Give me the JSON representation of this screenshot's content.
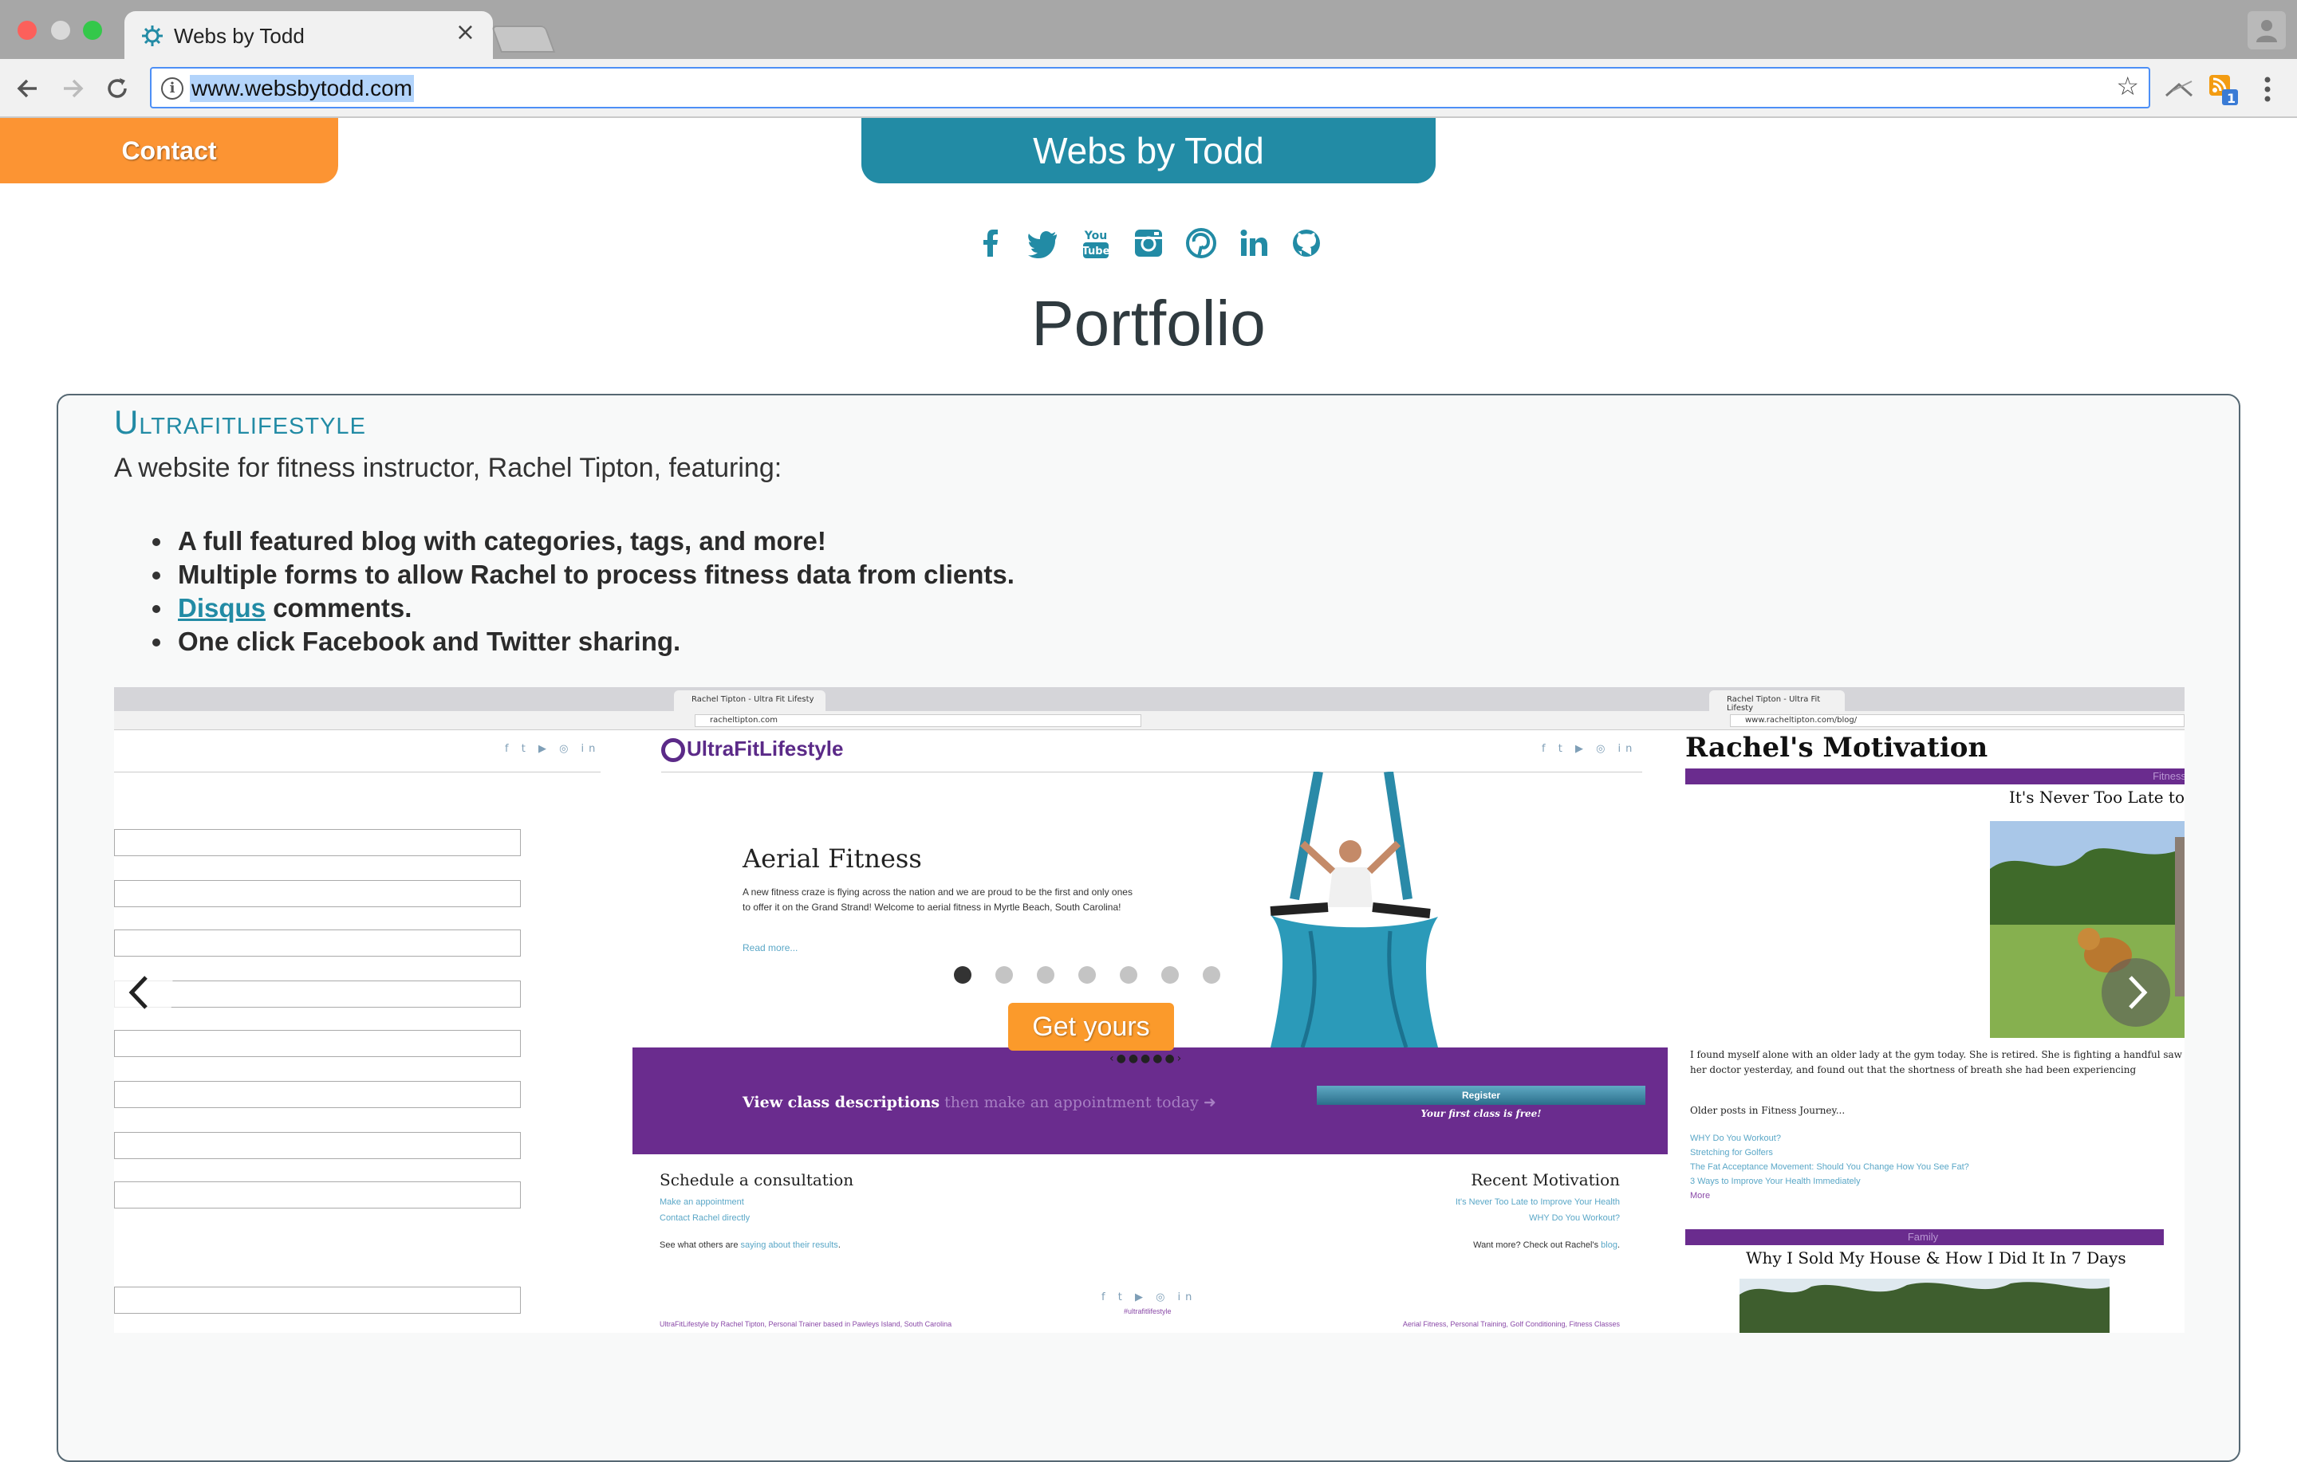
{
  "browser": {
    "tab_title": "Webs by Todd",
    "tab_close": "×",
    "url": "www.websbytodd.com",
    "extension_badge": "1"
  },
  "page": {
    "contact_label": "Contact",
    "brand": "Webs by Todd",
    "social_icons": [
      "facebook-icon",
      "twitter-icon",
      "youtube-icon",
      "instagram-icon",
      "pinterest-icon",
      "linkedin-icon",
      "github-icon"
    ],
    "heading": "Portfolio"
  },
  "project": {
    "title": "Ultrafitlifestyle",
    "description": "A website for fitness instructor, Rachel Tipton, featuring:",
    "features": [
      "A full featured blog with categories, tags, and more!",
      "Multiple forms to allow Rachel to process fitness data from clients.",
      "comments.",
      "One click Facebook and Twitter sharing."
    ],
    "feature_link": "Disqus",
    "cta_label": "Get yours",
    "carousel": {
      "dot_count": 7,
      "active_index": 0
    }
  },
  "slide": {
    "tab_title": "Rachel Tipton - Ultra Fit Lifesty",
    "url": "racheltipton.com",
    "blog_url": "www.racheltipton.com/blog/",
    "logo": "UltraFitLifestyle",
    "hero_title": "Aerial Fitness",
    "hero_text": "A new fitness craze is flying across the nation and we are proud to be the first and only ones to offer it on the Grand Strand! Welcome to aerial fitness in Myrtle Beach, South Carolina!",
    "hero_link": "Read more...",
    "cta_main": "View class descriptions",
    "cta_sub": "then make an appointment today",
    "register_label": "Register",
    "register_sub": "Your first class is free!",
    "schedule_heading": "Schedule a consultation",
    "schedule_link1": "Make an appointment",
    "schedule_link2": "Contact Rachel directly",
    "see_others": "See what others are",
    "see_others_link": "saying about their results",
    "recent_heading": "Recent Motivation",
    "recent_link1": "It's Never Too Late to Improve Your Health",
    "recent_link2": "WHY Do You Workout?",
    "want_more": "Want more? Check out Rachel's",
    "want_more_link": "blog",
    "footer_left": "UltraFitLifestyle by Rachel Tipton, Personal Trainer based in Pawleys Island, South Carolina",
    "footer_center": "#ultrafitlifestyle",
    "footer_right": "Aerial Fitness, Personal Training, Golf Conditioning, Fitness Classes",
    "blog_title": "Rachel's Motivation",
    "cat1": "Fitness",
    "post1_title": "It's Never Too Late to",
    "post1_text": "I found myself alone with an older lady at the gym today. She is retired. She is fighting a handful saw her doctor yesterday, and found out that the shortness of breath she had been experiencing",
    "older_heading": "Older posts in Fitness Journey...",
    "older_links": [
      "WHY Do You Workout?",
      "Stretching for Golfers",
      "The Fat Acceptance Movement: Should You Change How You See Fat?",
      "3 Ways to Improve Your Health Immediately"
    ],
    "more_link": "More",
    "cat2": "Family",
    "post2_title": "Why I Sold My House & How I Did It In 7 Days"
  },
  "colors": {
    "brand_teal": "#228ba5",
    "contact_orange": "#fc9433",
    "purple": "#6a2c8e"
  }
}
